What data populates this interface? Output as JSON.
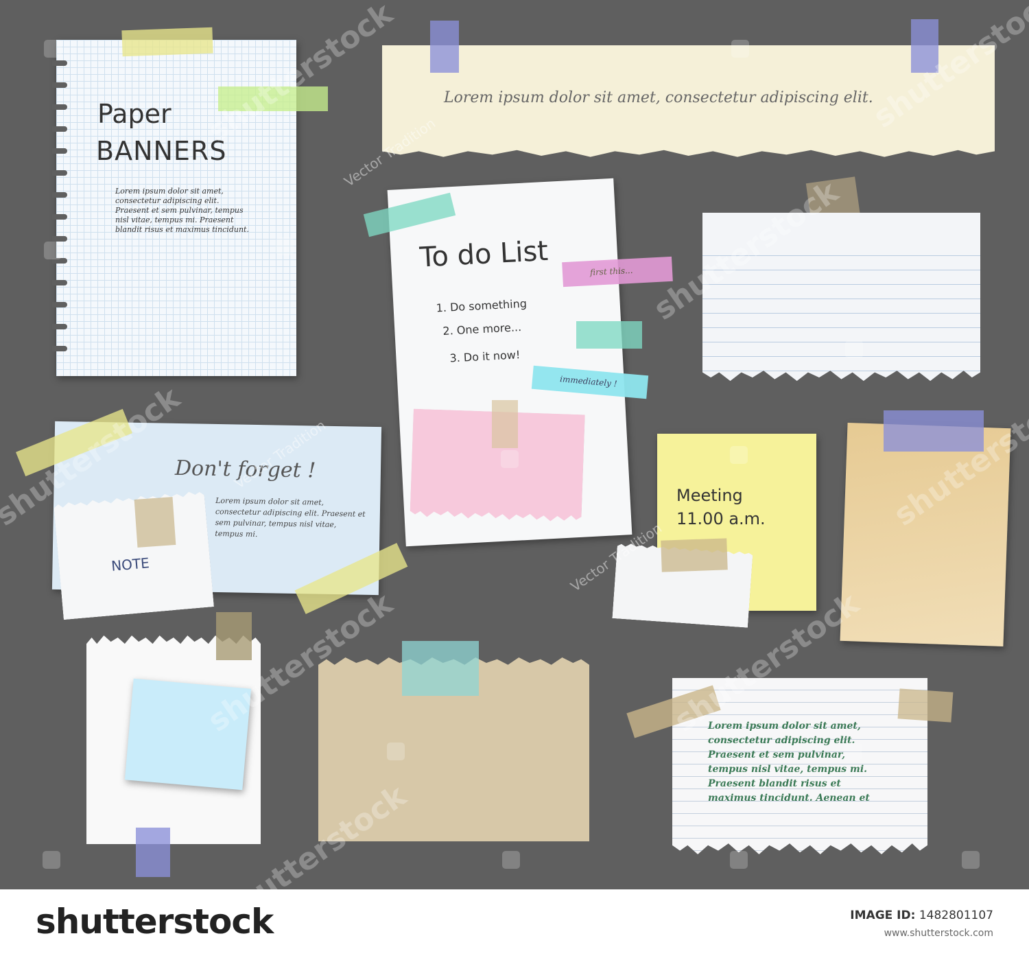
{
  "colors": {
    "background": "#5f5f5f",
    "tape_yellow": "#e8e58a",
    "tape_green": "#c7ee8d",
    "tape_purple": "#8b8fd8",
    "tape_teal": "#7fd8c3",
    "tape_pink": "#e39ad6",
    "tape_cyan": "#8fe6ef",
    "tape_tan": "#c9b58a"
  },
  "notes": {
    "grid_title_line1": "Paper",
    "grid_title_line2": "BANNERS",
    "grid_body": "Lorem ipsum dolor sit amet, consectetur adipiscing elit. Praesent et sem pulvinar, tempus nisl vitae, tempus mi. Praesent blandit risus et maximus tincidunt.",
    "banner_text": "Lorem ipsum dolor sit amet, consectetur adipiscing elit.",
    "todo_title": "To do List",
    "todo_item1": "1. Do something",
    "todo_item2": "2. One more...",
    "todo_item3": "3. Do it now!",
    "tab_first": "first this...",
    "tab_immediately": "immediately !",
    "dont_forget_title": "Don't forget !",
    "dont_forget_body": "Lorem ipsum dolor sit amet, consectetur adipiscing elit. Praesent et sem pulvinar, tempus nisl vitae, tempus mi.",
    "note_label": "NOTE",
    "meeting_line1": "Meeting",
    "meeting_line2": "11.00 a.m.",
    "green_body": [
      "Lorem ipsum dolor sit amet,",
      "consectetur adipiscing elit.",
      "Praesent et sem pulvinar,",
      "tempus nisl vitae, tempus mi.",
      "Praesent blandit risus et",
      "maximus tincidunt. Aenean et"
    ]
  },
  "watermark": {
    "brand": "shutterstock",
    "author": "Vector Tradition"
  },
  "footer": {
    "brand": "shutterstock",
    "image_id_label": "IMAGE ID:",
    "image_id": "1482801107",
    "site": "www.shutterstock.com"
  }
}
